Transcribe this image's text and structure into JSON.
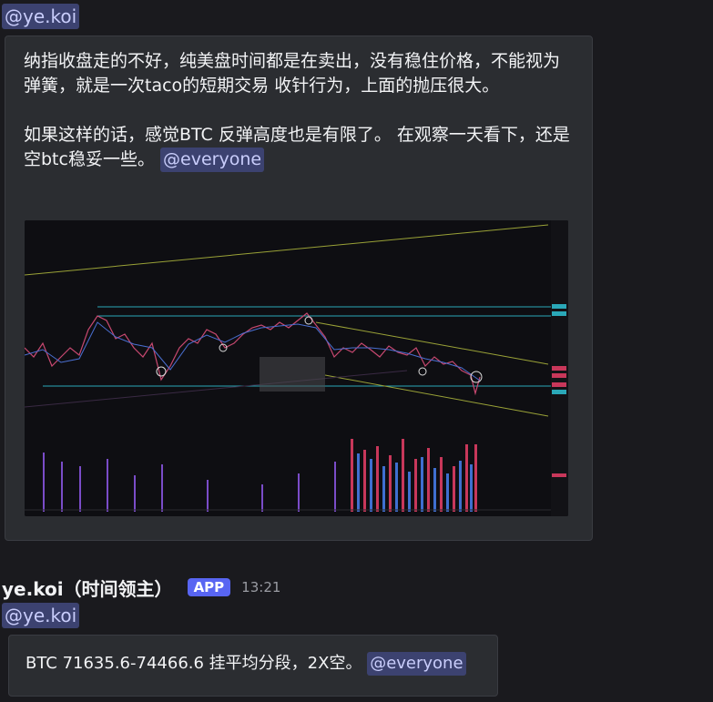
{
  "top_mention": "@ye.koi",
  "message1": {
    "paragraph1": "纳指收盘走的不好，纯美盘时间都是在卖出，没有稳住价格，不能视为弹簧，就是一次taco的短期交易 收针行为，上面的抛压很大。",
    "paragraph2": "如果这样的话，感觉BTC 反弹高度也是有限了。 在观察一天看下，还是空btc稳妥一些。",
    "mention": "@everyone"
  },
  "message2": {
    "username": "ye.koi（时间领主）",
    "badge": "APP",
    "timestamp": "13:21",
    "mention_line": "@ye.koi",
    "text": "BTC 71635.6-74466.6 挂平均分段，2X空。",
    "mention": "@everyone"
  },
  "colors": {
    "background": "#1a1a1e",
    "embed": "#2b2d31",
    "mention_bg": "#3c4270",
    "mention_fg": "#c9cdfb",
    "badge": "#5865f2"
  }
}
